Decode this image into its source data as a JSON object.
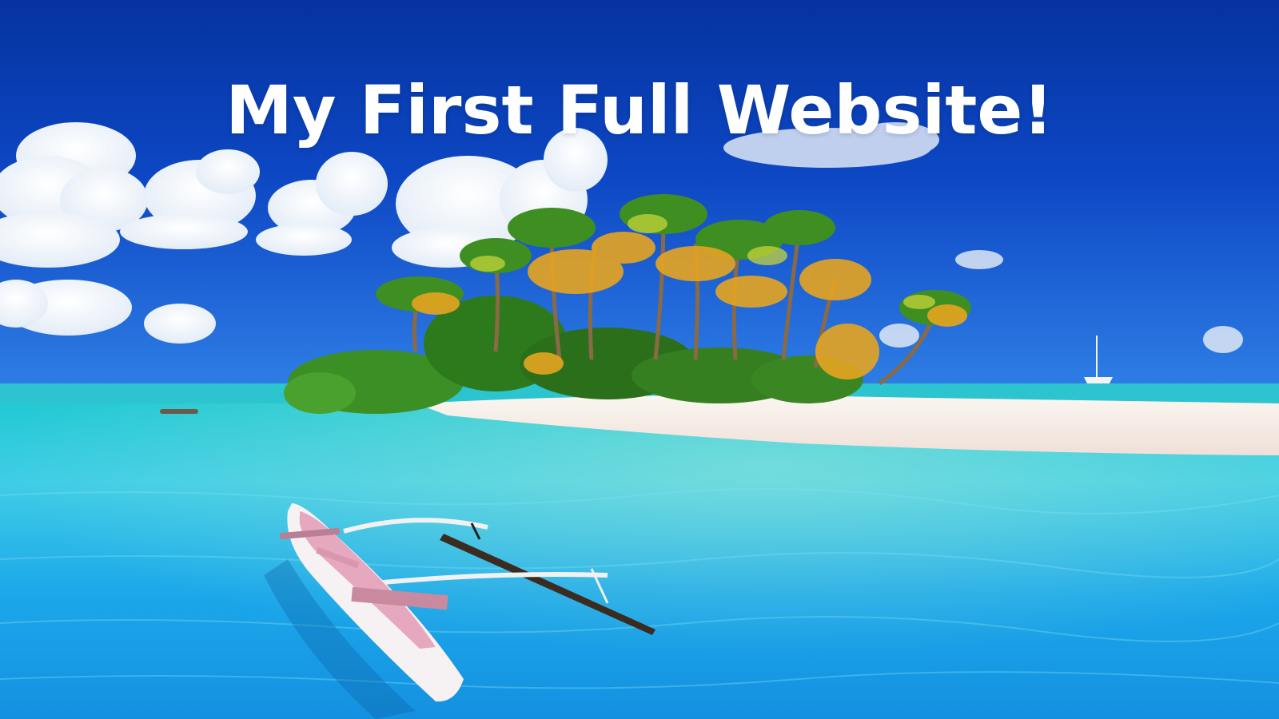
{
  "hero": {
    "title": "My First Full Website!"
  },
  "colors": {
    "sky_top": "#0636a8",
    "sky_mid": "#1656d2",
    "sky_horizon": "#3a86ee",
    "sea_far": "#1ec6d6",
    "sea_near": "#18a8e8",
    "sand": "#f6eee8",
    "foliage": "#2f8a1e",
    "palm_gold": "#e2a21b",
    "canoe_pink": "#e7b3c6"
  }
}
